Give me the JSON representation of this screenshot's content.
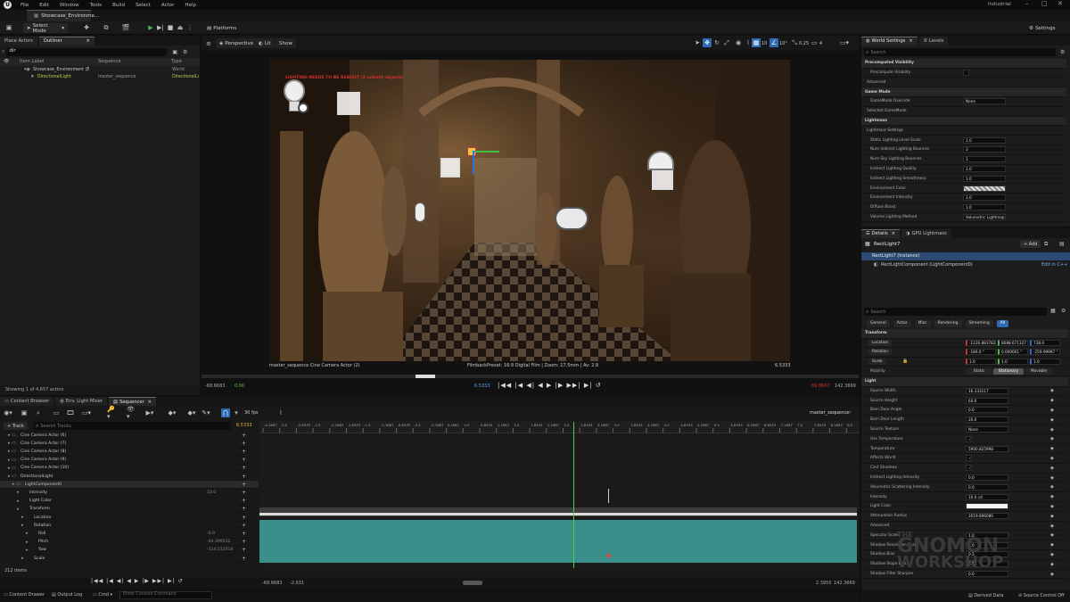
{
  "menus": [
    "File",
    "Edit",
    "Window",
    "Tools",
    "Build",
    "Select",
    "Actor",
    "Help"
  ],
  "document_tab": "Showcase_Environme...",
  "project_badge": "Industrial",
  "toolbar": {
    "select_mode": "Select Mode",
    "platforms": "Platforms",
    "settings": "Settings"
  },
  "outliner": {
    "tabs": [
      "Place Actors",
      "Outliner"
    ],
    "search_value": "dir",
    "columns": [
      "Item Label",
      "Sequence",
      "Type"
    ],
    "rows": [
      {
        "label": "Showcase_Environment (E",
        "sequence": "",
        "type": "World"
      },
      {
        "label": "DirectionalLight",
        "sequence": "master_sequence",
        "type": "DirectionalLi"
      }
    ],
    "status": "Showing 1 of 4,657 actors"
  },
  "viewport": {
    "perspective": "Perspective",
    "lit": "Lit",
    "show": "Show",
    "grid_snap": "10",
    "rot_snap": "10°",
    "scale_snap": "0.25",
    "camera_speed": "4",
    "warning": "LIGHTING NEEDS TO BE REBUILT (2 unbuilt objects)",
    "cam_label": "master_sequence  Cine Camera Actor (2)",
    "filmback": "FilmbackPreset: 16:9 Digital Film | Zoom: 17.5mm | Av: 2.8",
    "frame_right": "6.5333",
    "timeline": {
      "left_a": "-68.6683",
      "left_b": "0.00",
      "current": "6.5333",
      "right_a": "89.8667",
      "right_b": "142.3669"
    }
  },
  "world_settings": {
    "tabs": [
      "World Settings",
      "Levels"
    ],
    "search_placeholder": "Search",
    "rows": [
      {
        "label": "Precomputed Visibility",
        "value": "",
        "type": "section"
      },
      {
        "label": "Precompute Visibility",
        "value": "",
        "type": "check"
      },
      {
        "label": "Advanced",
        "value": "",
        "type": "sub"
      },
      {
        "label": "Game Mode",
        "value": "",
        "type": "section"
      },
      {
        "label": "GameMode Override",
        "value": "None",
        "type": "field"
      },
      {
        "label": "Selected GameMode",
        "value": "",
        "type": "sub"
      },
      {
        "label": "Lightmass",
        "value": "",
        "type": "section"
      },
      {
        "label": "Lightmass Settings",
        "value": "",
        "type": "sub"
      },
      {
        "label": "Static Lighting Level Scale",
        "value": "1.0",
        "type": "field"
      },
      {
        "label": "Num Indirect Lighting Bounces",
        "value": "3",
        "type": "field"
      },
      {
        "label": "Num Sky Lighting Bounces",
        "value": "1",
        "type": "field"
      },
      {
        "label": "Indirect Lighting Quality",
        "value": "1.0",
        "type": "field"
      },
      {
        "label": "Indirect Lighting Smoothness",
        "value": "1.0",
        "type": "field"
      },
      {
        "label": "Environment Color",
        "value": "",
        "type": "swatch"
      },
      {
        "label": "Environment Intensity",
        "value": "1.0",
        "type": "field"
      },
      {
        "label": "Diffuse Boost",
        "value": "1.0",
        "type": "field"
      },
      {
        "label": "Volume Lighting Method",
        "value": "Volumetric Lightmap",
        "type": "field"
      }
    ]
  },
  "details": {
    "tabs": [
      "Details",
      "GPU Lightmass"
    ],
    "actor_name": "RectLight7",
    "add_label": "+ Add",
    "instance": "RectLight7 (Instance)",
    "component": "RectLightComponent (LightComponent0)",
    "edit_link": "Edit in C++",
    "search_placeholder": "Search",
    "filters": [
      "General",
      "Actor",
      "Misc",
      "Rendering",
      "Streaming",
      "All"
    ],
    "transform": {
      "section": "Transform",
      "location_label": "Location",
      "location": [
        "-1226.883782",
        "8088.671327",
        "738.0"
      ],
      "rotation_label": "Rotation",
      "rotation": [
        "-189.0 °",
        "0.000001 °",
        "-259.99997 °"
      ],
      "scale_label": "Scale",
      "scale": [
        "1.0",
        "1.0",
        "1.0"
      ],
      "mobility_label": "Mobility",
      "mobility": [
        "Static",
        "Stationary",
        "Movable"
      ]
    },
    "light_section": "Light",
    "light_rows": [
      {
        "label": "Source Width",
        "value": "16.333117"
      },
      {
        "label": "Source Height",
        "value": "64.0"
      },
      {
        "label": "Barn Door Angle",
        "value": "0.0"
      },
      {
        "label": "Barn Door Length",
        "value": "20.0"
      },
      {
        "label": "Source Texture",
        "value": "None"
      },
      {
        "label": "Use Temperature",
        "value": ""
      },
      {
        "label": "Temperature",
        "value": "5900.825998"
      },
      {
        "label": "Affects World",
        "value": ""
      },
      {
        "label": "Cast Shadows",
        "value": ""
      },
      {
        "label": "Indirect Lighting Intensity",
        "value": "0.0"
      },
      {
        "label": "Volumetric Scattering Intensity",
        "value": "0.0"
      },
      {
        "label": "Intensity",
        "value": "10.0 cd"
      },
      {
        "label": "Light Color",
        "value": ""
      },
      {
        "label": "Attenuation Radius",
        "value": "2019.896089"
      },
      {
        "label": "Advanced",
        "value": ""
      },
      {
        "label": "Specular Scale",
        "value": "1.0"
      },
      {
        "label": "Shadow Resolution Scale",
        "value": "1.0"
      },
      {
        "label": "Shadow Bias",
        "value": "0.5"
      },
      {
        "label": "Shadow Slope Bias",
        "value": "0.5"
      },
      {
        "label": "Shadow Filter Sharpen",
        "value": "0.0"
      }
    ],
    "footer_left": "Derived Data",
    "footer_right": "Source Control Off"
  },
  "sequencer": {
    "tabs": [
      "Content Browser",
      "Env. Light Mixer",
      "Sequencer"
    ],
    "fps": "30 fps",
    "name": "master_sequence",
    "track_button": "+ Track",
    "search_placeholder": "Search Tracks",
    "current_frame": "6.5333",
    "ruler": [
      "-4.1667",
      "-3.0",
      "-2.8333",
      "-2.5",
      "-2.1667",
      "-1.8333",
      "-1.5",
      "-1.1667",
      "-0.8333",
      "-0.5",
      "-0.1667",
      "0.1667",
      "0.5",
      "0.8333",
      "1.1667",
      "1.5",
      "1.8333",
      "2.1667",
      "2.5",
      "2.8333",
      "3.1667",
      "3.5",
      "3.8333",
      "4.1667",
      "4.5",
      "4.8333",
      "5.1667",
      "5.5",
      "5.8333",
      "6.1667",
      "6.8333",
      "7.1667",
      "7.5",
      "7.8333",
      "8.1667",
      "8.5"
    ],
    "tracks": [
      {
        "label": "Cine Camera Actor (6)",
        "indent": 1,
        "value": ""
      },
      {
        "label": "Cine Camera Actor (7)",
        "indent": 1,
        "value": ""
      },
      {
        "label": "Cine Camera Actor (8)",
        "indent": 1,
        "value": ""
      },
      {
        "label": "Cine Camera Actor (9)",
        "indent": 1,
        "value": ""
      },
      {
        "label": "Cine Camera Actor (10)",
        "indent": 1,
        "value": ""
      },
      {
        "label": "DirectionalLight",
        "indent": 1,
        "value": ""
      },
      {
        "label": "LightComponent0",
        "indent": 2,
        "value": ""
      },
      {
        "label": "Intensity",
        "indent": 3,
        "value": "10.0"
      },
      {
        "label": "Light Color",
        "indent": 3,
        "value": ""
      },
      {
        "label": "Transform",
        "indent": 3,
        "value": ""
      },
      {
        "label": "Location",
        "indent": 4,
        "value": ""
      },
      {
        "label": "Rotation",
        "indent": 4,
        "value": ""
      },
      {
        "label": "Roll",
        "indent": 5,
        "value": "-0.0"
      },
      {
        "label": "Pitch",
        "indent": 5,
        "value": "-44.399532"
      },
      {
        "label": "Yaw",
        "indent": 5,
        "value": "-114.512514"
      },
      {
        "label": "Scale",
        "indent": 4,
        "value": ""
      }
    ],
    "items_count": "212 items",
    "bottom_left_a": "-68.6683",
    "bottom_left_b": "-2.631",
    "bottom_right_a": "2.3955",
    "bottom_right_b": "142.3669"
  },
  "statusbar": {
    "content_drawer": "Content Drawer",
    "output_log": "Output Log",
    "cmd": "Cmd",
    "console_placeholder": "Enter Console Command"
  },
  "watermark": [
    "THE",
    "GNOMON",
    "WORKSHOP"
  ]
}
